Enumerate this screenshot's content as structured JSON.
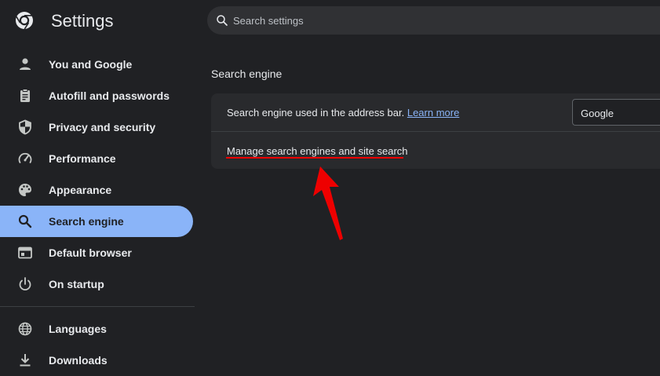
{
  "header": {
    "app_title": "Settings",
    "search_placeholder": "Search settings",
    "icons": {
      "logo": "chrome-logo-icon",
      "search": "search-icon"
    }
  },
  "sidebar": {
    "items": [
      {
        "label": "You and Google",
        "icon": "person-icon",
        "active": false
      },
      {
        "label": "Autofill and passwords",
        "icon": "clipboard-icon",
        "active": false
      },
      {
        "label": "Privacy and security",
        "icon": "shield-icon",
        "active": false
      },
      {
        "label": "Performance",
        "icon": "speedometer-icon",
        "active": false
      },
      {
        "label": "Appearance",
        "icon": "palette-icon",
        "active": false
      },
      {
        "label": "Search engine",
        "icon": "search-icon",
        "active": true
      },
      {
        "label": "Default browser",
        "icon": "browser-window-icon",
        "active": false
      },
      {
        "label": "On startup",
        "icon": "power-icon",
        "active": false
      },
      {
        "label": "Languages",
        "icon": "globe-icon",
        "active": false
      },
      {
        "label": "Downloads",
        "icon": "download-icon",
        "active": false
      }
    ]
  },
  "main": {
    "section_title": "Search engine",
    "row1": {
      "text": "Search engine used in the address bar.",
      "link": "Learn more",
      "selected_engine": "Google"
    },
    "row2": {
      "text": "Manage search engines and site search"
    }
  },
  "annotation": {
    "color": "#ee0000",
    "shape": "arrow-pointing-up"
  },
  "colors": {
    "background": "#202124",
    "card": "#292a2d",
    "accent": "#8ab4f8",
    "text": "#e8eaed"
  }
}
